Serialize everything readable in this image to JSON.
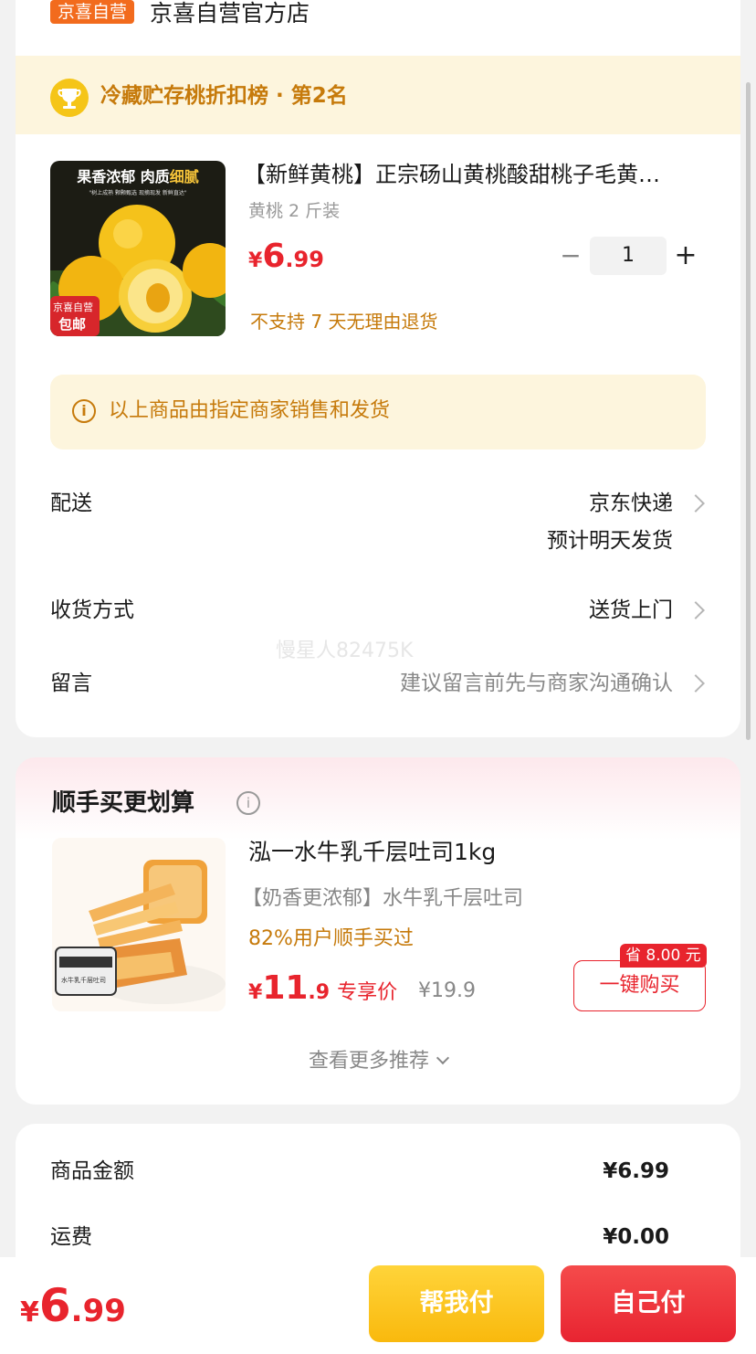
{
  "store": {
    "badge": "京喜自营",
    "name": "京喜自营官方店",
    "rank": "冷藏贮存桃折扣榜 · 第2名"
  },
  "product": {
    "title": "【新鲜黄桃】正宗砀山黄桃酸甜桃子毛黄…",
    "spec": "黄桃 2 斤装",
    "price_symbol": "¥",
    "price_int": "6",
    "price_dec": ".99",
    "quantity": "1",
    "minus": "−",
    "plus": "+",
    "no_return": "不支持 7 天无理由退货",
    "image": {
      "headline_a": "果香浓郁 肉质",
      "headline_b": "细腻",
      "subline": "\"树上成熟 颗颗甄选 现摘现发 新鲜直达\"",
      "badge_top": "京喜自营",
      "badge_bottom": "包邮"
    }
  },
  "notice": {
    "icon": "i",
    "text": "以上商品由指定商家销售和发货"
  },
  "delivery": {
    "label": "配送",
    "value_1": "京东快递",
    "value_2": "预计明天发货"
  },
  "receive": {
    "label": "收货方式",
    "value": "送货上门"
  },
  "message": {
    "label": "留言",
    "placeholder": "建议留言前先与商家沟通确认"
  },
  "watermark": "慢星人82475K",
  "recommend": {
    "title": "顺手买更划算",
    "info_icon": "i",
    "name": "泓一水牛乳千层吐司1kg",
    "sub": "【奶香更浓郁】水牛乳千层吐司",
    "sales": "82%用户顺手买过",
    "price_symbol": "¥",
    "price_int": "11",
    "price_dec": ".9",
    "price_tag": "专享价",
    "orig_price": "¥19.9",
    "save_tag": "省 8.00 元",
    "buy_label": "一键购买",
    "more_label": "查看更多推荐",
    "img_label": "水牛乳千层吐司"
  },
  "summary": {
    "goods_label": "商品金额",
    "goods_value": "¥6.99",
    "shipping_label": "运费",
    "shipping_value": "¥0.00"
  },
  "bottom": {
    "total_symbol": "¥",
    "total_int": "6",
    "total_dec": ".99",
    "help_pay": "帮我付",
    "self_pay": "自己付"
  },
  "colors": {
    "accent_red": "#e8242d",
    "accent_orange": "#c67a0b",
    "badge_orange": "#f26b1d",
    "help_yellow": "#f9b90d"
  }
}
